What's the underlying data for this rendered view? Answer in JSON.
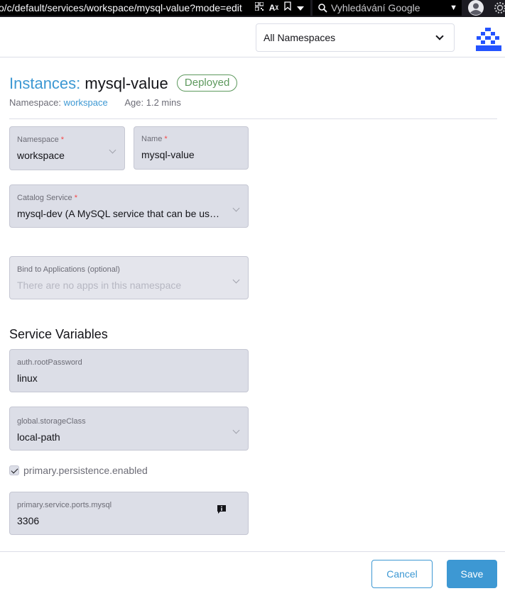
{
  "browser": {
    "url": "o/c/default/services/workspace/mysql-value?mode=edit",
    "search_placeholder": "Vyhledávání Google"
  },
  "header": {
    "namespace_filter": "All Namespaces"
  },
  "page": {
    "resource_label": "Instances:",
    "name": "mysql-value",
    "state": "Deployed",
    "namespace_label": "Namespace:",
    "namespace_value": "workspace",
    "age_label": "Age:",
    "age_value": "1.2 mins"
  },
  "form": {
    "namespace": {
      "label": "Namespace",
      "required": "*",
      "value": "workspace"
    },
    "name": {
      "label": "Name",
      "required": "*",
      "value": "mysql-value"
    },
    "catalog_service": {
      "label": "Catalog Service",
      "required": "*",
      "value": "mysql-dev (A MySQL service that can be us…"
    },
    "bind_apps": {
      "label": "Bind to Applications (optional)",
      "placeholder": "There are no apps in this namespace"
    },
    "service_variables_title": "Service Variables",
    "root_password": {
      "label": "auth.rootPassword",
      "value": "linux"
    },
    "storage_class": {
      "label": "global.storageClass",
      "value": "local-path"
    },
    "persistence": {
      "label": "primary.persistence.enabled",
      "checked": true
    },
    "ports_mysql": {
      "label": "primary.service.ports.mysql",
      "value": "3306"
    }
  },
  "footer": {
    "cancel_label": "Cancel",
    "save_label": "Save"
  },
  "colors": {
    "accent": "#3d98d3",
    "success": "#5d995d",
    "required": "#f64747",
    "field_bg": "#dcdee7"
  },
  "icons": [
    "qr-code-icon",
    "translate-icon",
    "bookmark-icon",
    "dropdown-icon",
    "search-icon",
    "avatar-icon",
    "settings-icon",
    "logo-icon",
    "chevron-down-icon",
    "info-icon",
    "checkmark-icon"
  ]
}
